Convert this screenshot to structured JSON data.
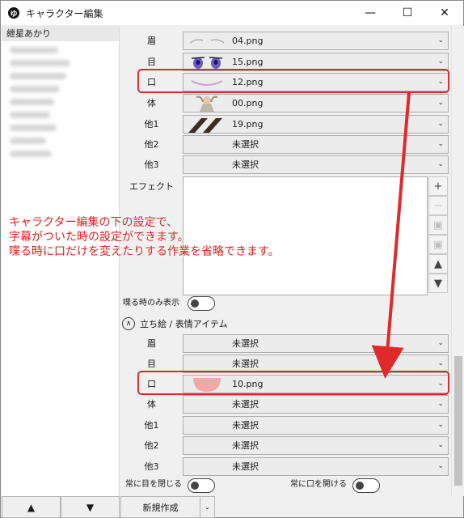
{
  "window": {
    "app_icon": "ゆ",
    "title": "キャラクター編集",
    "minimize_icon": "minimize-icon",
    "maximize_icon": "maximize-icon",
    "close_icon": "close-icon",
    "minimize_glyph": "—",
    "maximize_glyph": "☐",
    "close_glyph": "✕"
  },
  "character_list": {
    "selected": "紲星あかり"
  },
  "left_footer": {
    "up_glyph": "▲",
    "down_glyph": "▼"
  },
  "face_items": [
    {
      "label": "眉",
      "value": "04.png"
    },
    {
      "label": "目",
      "value": "15.png"
    },
    {
      "label": "口",
      "value": "12.png"
    },
    {
      "label": "体",
      "value": "00.png"
    },
    {
      "label": "他1",
      "value": "19.png"
    },
    {
      "label": "他2",
      "value": "未選択"
    },
    {
      "label": "他3",
      "value": "未選択"
    }
  ],
  "effect": {
    "label": "エフェクト",
    "buttons": [
      "+",
      "−",
      "▣",
      "▣",
      "▲",
      "▼"
    ]
  },
  "speaking_only": {
    "label": "喋る時のみ表示"
  },
  "standing_section": {
    "collapse_glyph": "∧",
    "title": "立ち絵 / 表情アイテム",
    "items": [
      {
        "label": "眉",
        "value": "未選択"
      },
      {
        "label": "目",
        "value": "未選択"
      },
      {
        "label": "口",
        "value": "10.png"
      },
      {
        "label": "体",
        "value": "未選択"
      },
      {
        "label": "他1",
        "value": "未選択"
      },
      {
        "label": "他2",
        "value": "未選択"
      },
      {
        "label": "他3",
        "value": "未選択"
      }
    ]
  },
  "toggles": {
    "eyes_closed": "常に目を閉じる",
    "mouth_open": "常に口を開ける"
  },
  "bottom_bar": {
    "new_button": "新規作成",
    "dropdown_glyph": "⌄"
  },
  "chevron_glyph": "⌄",
  "annotation": {
    "lines": [
      "キャラクター編集の下の設定で、",
      "字幕がついた時の設定ができます。",
      "喋る時に口だけを変えたりする作業を省略できます。"
    ],
    "color": "#e41d1d"
  }
}
